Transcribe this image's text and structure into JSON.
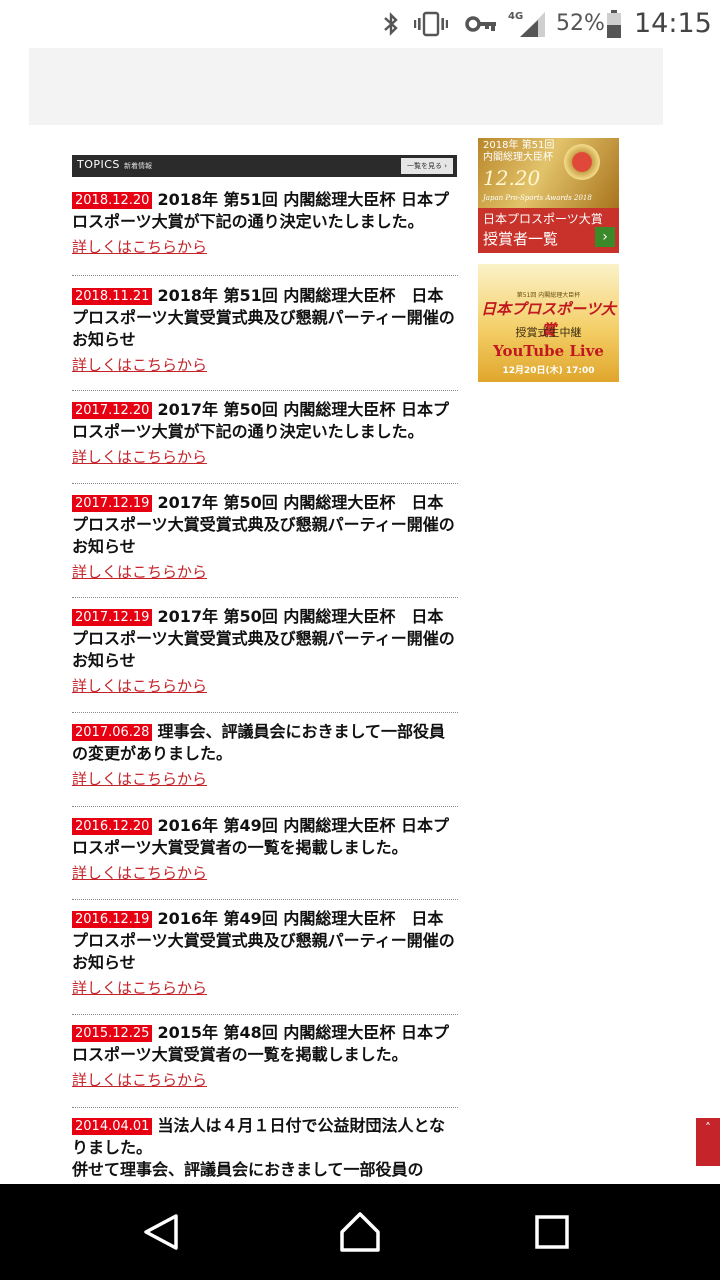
{
  "status_bar": {
    "network": "4G",
    "battery_pct": "52%",
    "time": "14:15"
  },
  "topics": {
    "title": "TOPICS",
    "subtitle": "新着情報",
    "more_label": "一覧を見る ›"
  },
  "news": [
    {
      "date": "2018.12.20",
      "title": "2018年 第51回 内閣総理大臣杯 日本プロスポーツ大賞が下記の通り決定いたしました。",
      "link": "詳しくはこちらから"
    },
    {
      "date": "2018.11.21",
      "title": "2018年 第51回 内閣総理大臣杯　日本プロスポーツ大賞受賞式典及び懇親パーティー開催のお知らせ",
      "link": "詳しくはこちらから"
    },
    {
      "date": "2017.12.20",
      "title": "2017年 第50回 内閣総理大臣杯 日本プロスポーツ大賞が下記の通り決定いたしました。",
      "link": "詳しくはこちらから"
    },
    {
      "date": "2017.12.19",
      "title": "2017年 第50回 内閣総理大臣杯　日本プロスポーツ大賞受賞式典及び懇親パーティー開催のお知らせ",
      "link": "詳しくはこちらから"
    },
    {
      "date": "2017.12.19",
      "title": "2017年 第50回 内閣総理大臣杯　日本プロスポーツ大賞受賞式典及び懇親パーティー開催のお知らせ",
      "link": "詳しくはこちらから"
    },
    {
      "date": "2017.06.28",
      "title": "理事会、評議員会におきまして一部役員の変更がありました。",
      "link": "詳しくはこちらから"
    },
    {
      "date": "2016.12.20",
      "title": "2016年 第49回 内閣総理大臣杯 日本プロスポーツ大賞受賞者の一覧を掲載しました。",
      "link": "詳しくはこちらから"
    },
    {
      "date": "2016.12.19",
      "title": "2016年 第49回 内閣総理大臣杯　日本プロスポーツ大賞受賞式典及び懇親パーティー開催のお知らせ",
      "link": "詳しくはこちらから"
    },
    {
      "date": "2015.12.25",
      "title": "2015年 第48回 内閣総理大臣杯 日本プロスポーツ大賞受賞者の一覧を掲載しました。",
      "link": "詳しくはこちらから"
    },
    {
      "date": "2014.04.01",
      "title": "当法人は４月１日付で公益財団法人となりました。",
      "title2": "併せて理事会、評議員会におきまして一部役員の"
    }
  ],
  "banners": {
    "awards": {
      "line1": "2018年 第51回",
      "line2": "内閣総理大臣杯",
      "date": "12.20",
      "english": "Japan Pro-Sports Awards 2018",
      "caption1": "日本プロスポーツ大賞",
      "caption2": "授賞者一覧"
    },
    "live": {
      "small": "第51回 内閣総理大臣杯",
      "title": "日本プロスポーツ大賞",
      "subtitle": "授賞式生中継",
      "youtube": "YouTube Live",
      "datetime": "12月20日(木) 17:00"
    }
  },
  "scroll_top": "˄"
}
